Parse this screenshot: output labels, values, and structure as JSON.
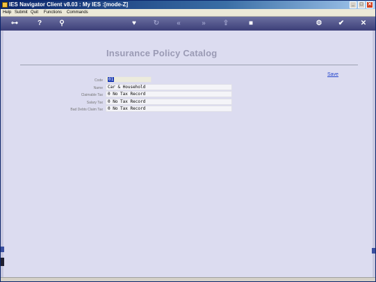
{
  "window": {
    "title": "IES Navigator Client v8.03 : My IES :",
    "mode": "[mode-Z]"
  },
  "menu": {
    "items": [
      "Help",
      "Submit",
      "Quit",
      "Functions",
      "Commands"
    ]
  },
  "page": {
    "title": "Insurance Policy Catalog",
    "save_label": "Save"
  },
  "form": {
    "code_label": "Code",
    "code_value": "01",
    "name_label": "Name",
    "name_value": "Car & Household",
    "claimable_tax_label": "Claimable Tax",
    "claimable_tax_value": "0 No Tax Record",
    "salary_tax_label": "Salary Tax",
    "salary_tax_value": "0 No Tax Record",
    "bad_debts_label": "Bad Debts Claim Tax",
    "bad_debts_value": "0 No Tax Record"
  },
  "colors": {
    "accent": "#1c3bb4",
    "toolbar": "#3c3f78",
    "content_bg": "#dcdcf0"
  }
}
